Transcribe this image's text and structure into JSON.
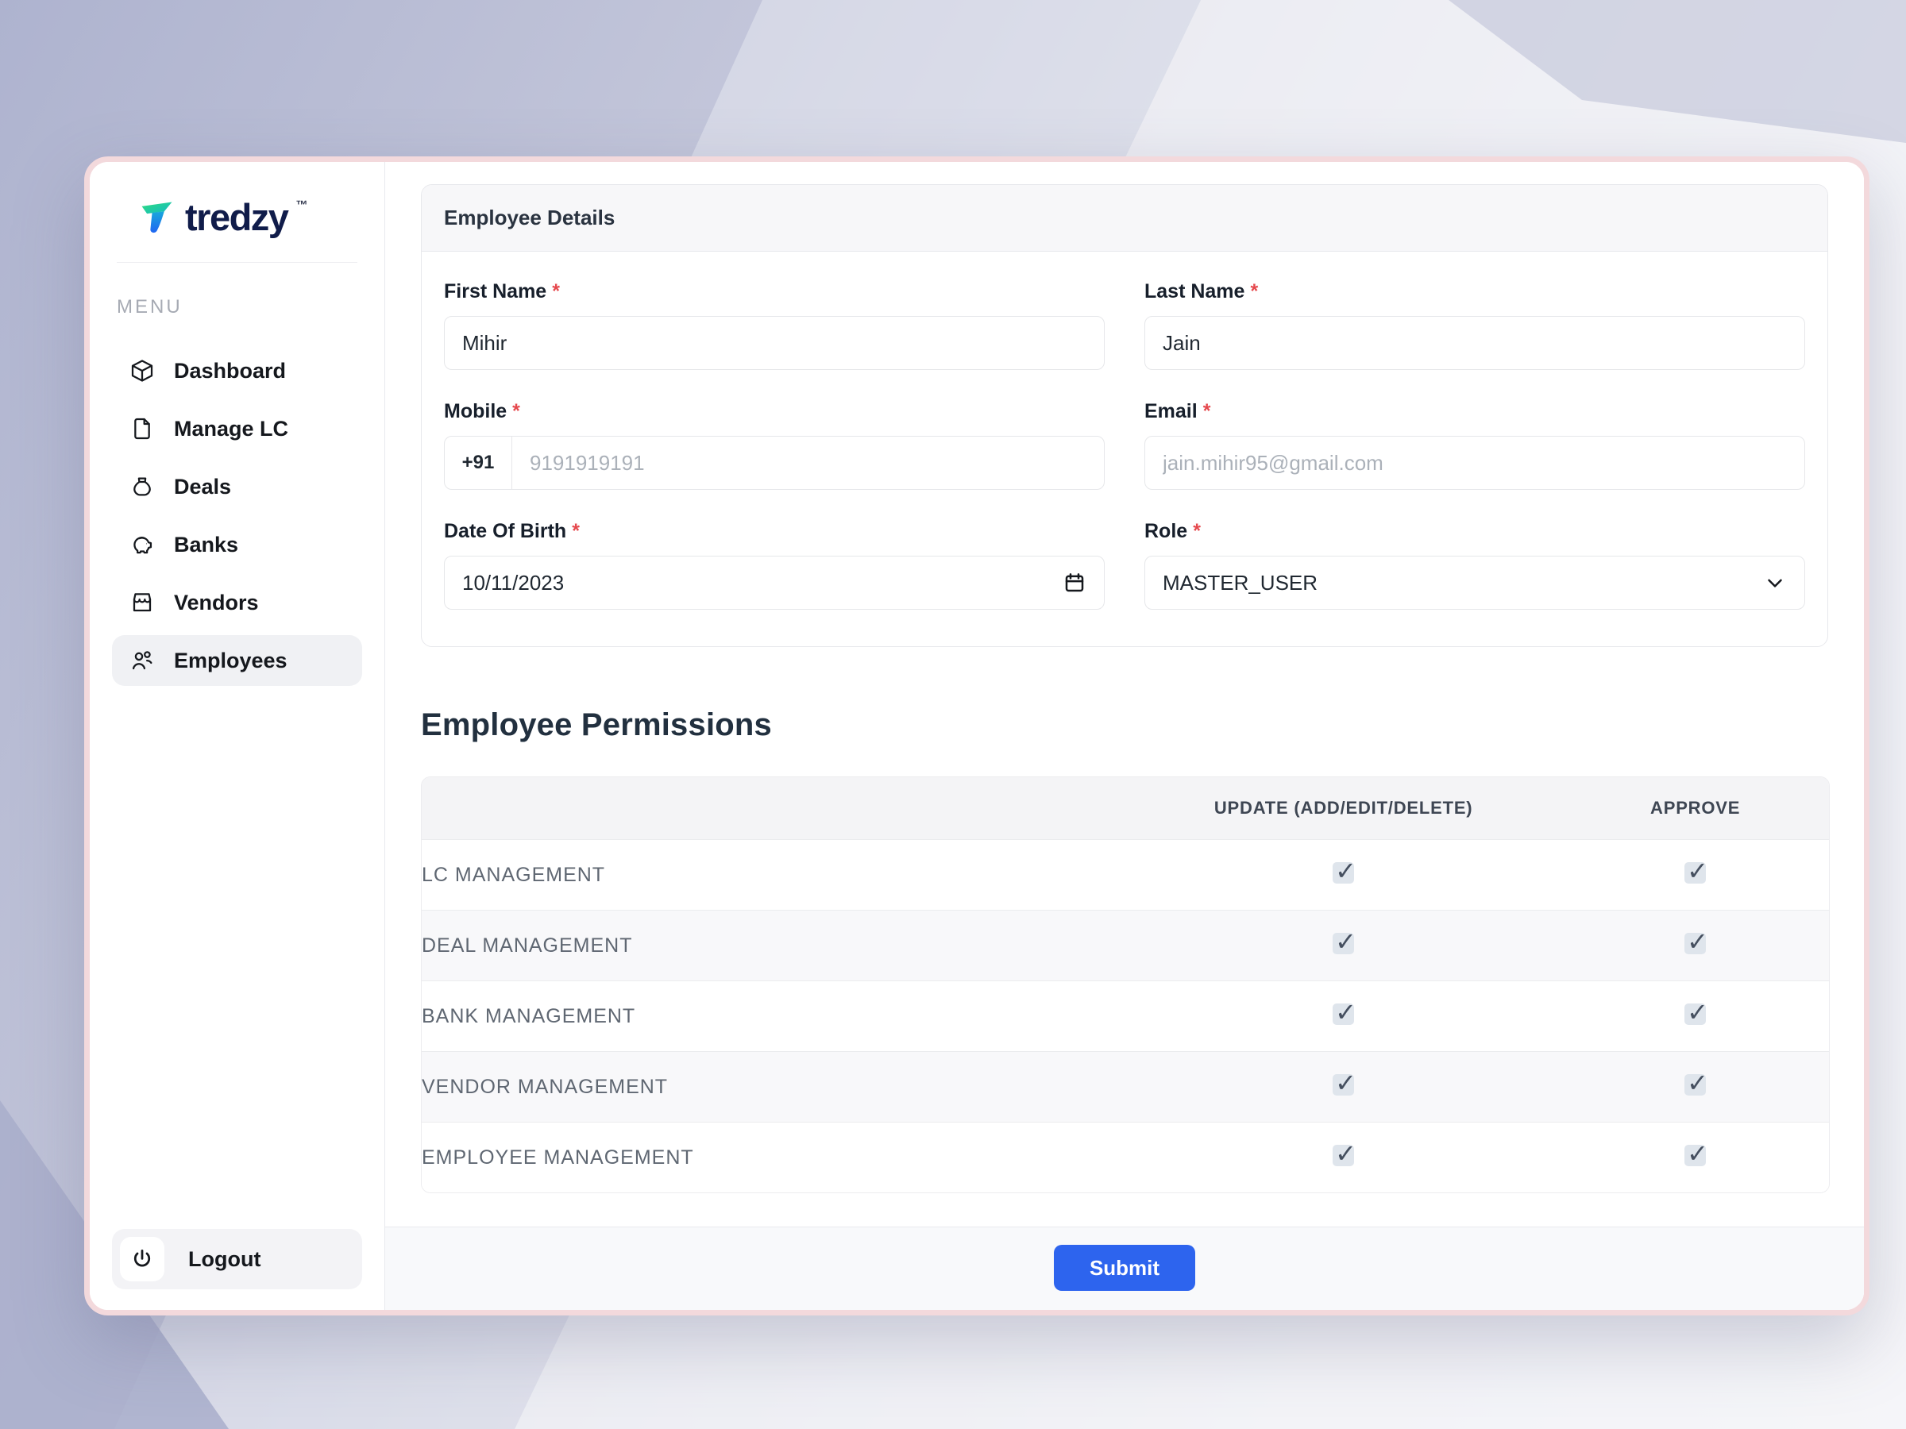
{
  "brand": {
    "name": "tredzy",
    "trademark": "™"
  },
  "sidebar": {
    "menu_label": "MENU",
    "items": [
      {
        "label": "Dashboard",
        "icon": "cube-icon",
        "active": false
      },
      {
        "label": "Manage LC",
        "icon": "document-icon",
        "active": false
      },
      {
        "label": "Deals",
        "icon": "money-bag-icon",
        "active": false
      },
      {
        "label": "Banks",
        "icon": "piggy-bank-icon",
        "active": false
      },
      {
        "label": "Vendors",
        "icon": "storefront-icon",
        "active": false
      },
      {
        "label": "Employees",
        "icon": "users-icon",
        "active": true
      }
    ],
    "logout": {
      "label": "Logout",
      "icon": "power-icon"
    }
  },
  "employee_details": {
    "title": "Employee Details",
    "required_marker": "*",
    "fields": {
      "first_name": {
        "label": "First Name",
        "required": true,
        "value": "Mihir"
      },
      "last_name": {
        "label": "Last Name",
        "required": true,
        "value": "Jain"
      },
      "mobile": {
        "label": "Mobile",
        "required": true,
        "prefix": "+91",
        "placeholder": "9191919191",
        "value": ""
      },
      "email": {
        "label": "Email",
        "required": true,
        "placeholder": "jain.mihir95@gmail.com",
        "value": ""
      },
      "date_of_birth": {
        "label": "Date Of Birth",
        "required": true,
        "value": "10/11/2023",
        "icon": "calendar-icon"
      },
      "role": {
        "label": "Role",
        "required": true,
        "value": "MASTER_USER",
        "icon": "chevron-down-icon"
      }
    }
  },
  "permissions": {
    "title": "Employee Permissions",
    "columns": {
      "update": "UPDATE (ADD/EDIT/DELETE)",
      "approve": "APPROVE"
    },
    "rows": [
      {
        "label": "LC MANAGEMENT",
        "update_checked": true,
        "approve_checked": true
      },
      {
        "label": "DEAL MANAGEMENT",
        "update_checked": true,
        "approve_checked": true
      },
      {
        "label": "BANK MANAGEMENT",
        "update_checked": true,
        "approve_checked": true
      },
      {
        "label": "VENDOR MANAGEMENT",
        "update_checked": true,
        "approve_checked": true
      },
      {
        "label": "EMPLOYEE MANAGEMENT",
        "update_checked": true,
        "approve_checked": true
      }
    ]
  },
  "footer": {
    "submit_label": "Submit"
  },
  "colors": {
    "accent_blue": "#2d64ee",
    "required_red": "#e5484d",
    "brand_navy": "#101c4a",
    "brand_green": "#2ede7c",
    "brand_blue": "#1f66f2",
    "card_border_pink": "#f3d9dc",
    "checkbox_bg": "#dfe5ec",
    "checkbox_check": "#454f5f"
  }
}
